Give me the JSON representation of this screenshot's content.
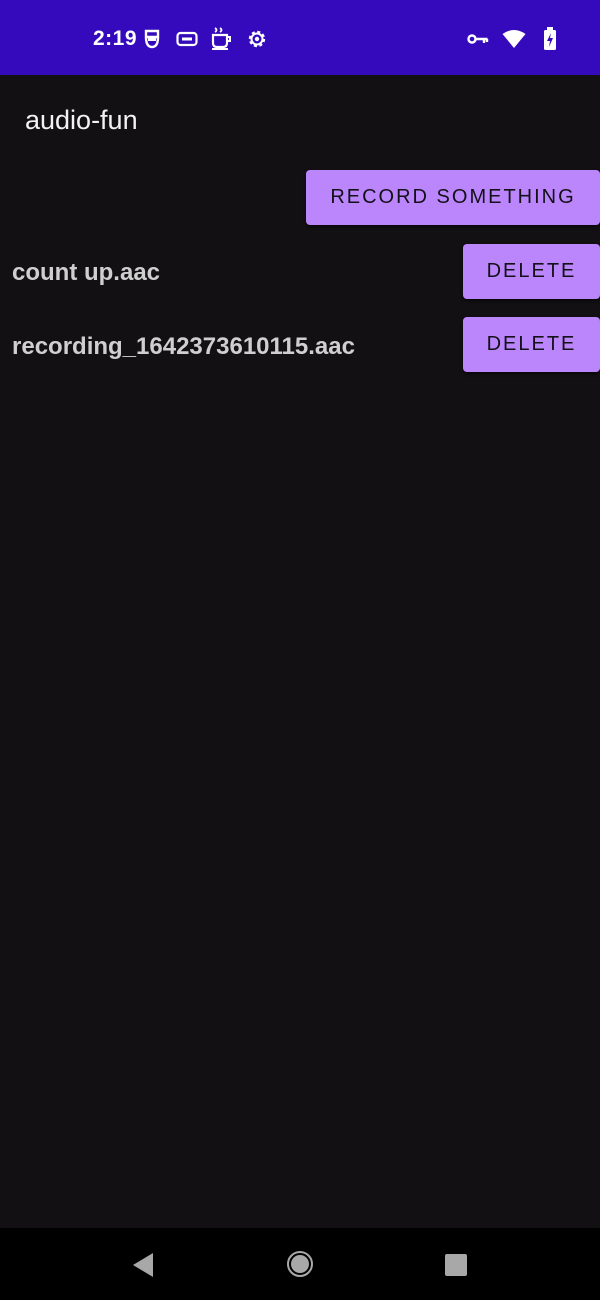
{
  "status_bar": {
    "time": "2:19",
    "background": "#3509BC",
    "left_icons": [
      "mask-notification-icon",
      "cast-notification-icon",
      "coffee-notification-icon",
      "settings-notification-icon"
    ],
    "right_icons": [
      "vpn-key-icon",
      "wifi-icon",
      "battery-charging-icon"
    ]
  },
  "app": {
    "title": "audio-fun",
    "accent": "#BB86FC",
    "background": "#131013"
  },
  "actions": {
    "record_label": "RECORD SOMETHING"
  },
  "recordings": [
    {
      "name": "count up.aac",
      "delete_label": "DELETE"
    },
    {
      "name": "recording_1642373610115.aac",
      "delete_label": "DELETE"
    }
  ],
  "nav_bar": {
    "icons": [
      "back-icon",
      "home-icon",
      "recents-icon"
    ]
  }
}
